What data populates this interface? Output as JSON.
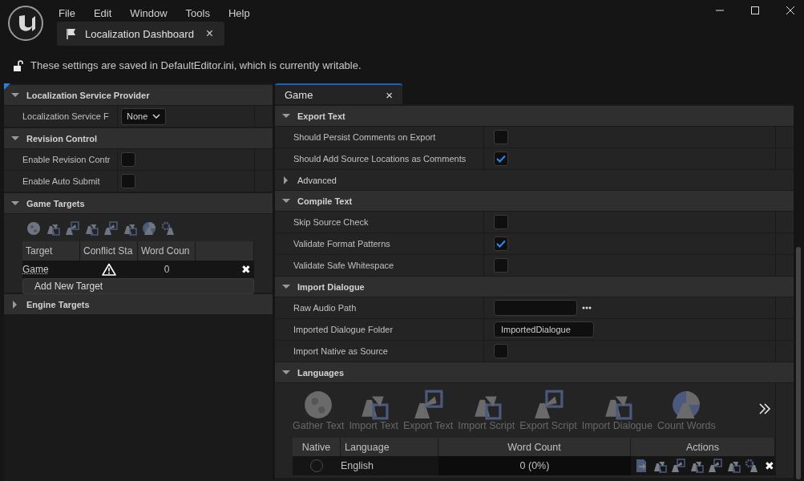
{
  "menu": [
    "File",
    "Edit",
    "Window",
    "Tools",
    "Help"
  ],
  "document_tab": {
    "label": "Localization Dashboard",
    "close": "×"
  },
  "notice": "These settings are saved in DefaultEditor.ini, which is currently writable.",
  "left_panel": {
    "sections": [
      {
        "kind": "properties",
        "title": "Localization Service Provider",
        "expanded": true,
        "rows": [
          {
            "kind": "dropdown",
            "label": "Localization Service F",
            "value": "None"
          }
        ]
      },
      {
        "kind": "properties",
        "title": "Revision Control",
        "expanded": true,
        "rows": [
          {
            "kind": "checkbox",
            "label": "Enable Revision Contr",
            "checked": false
          },
          {
            "kind": "checkbox",
            "label": "Enable Auto Submit",
            "checked": false
          }
        ]
      },
      {
        "kind": "targets",
        "title": "Game Targets",
        "expanded": true,
        "columns": [
          "Target",
          "Conflict Sta",
          "Word Coun"
        ],
        "rows": [
          {
            "target": "Game",
            "conflict": true,
            "word_count": "0",
            "remove": "✖"
          }
        ],
        "add_button": "Add New Target"
      },
      {
        "kind": "properties",
        "title": "Engine Targets",
        "expanded": false
      }
    ]
  },
  "editor_tab": {
    "label": "Game",
    "close": "×"
  },
  "right_panel": {
    "sections": [
      {
        "kind": "properties",
        "title": "Export Text",
        "expanded": true,
        "rows": [
          {
            "kind": "checkbox",
            "label": "Should Persist Comments on Export",
            "checked": false
          },
          {
            "kind": "checkbox",
            "label": "Should Add Source Locations as Comments",
            "checked": true
          }
        ]
      },
      {
        "kind": "group",
        "title": "Advanced",
        "expanded": false
      },
      {
        "kind": "properties",
        "title": "Compile Text",
        "expanded": true,
        "rows": [
          {
            "kind": "checkbox",
            "label": "Skip Source Check",
            "checked": false
          },
          {
            "kind": "checkbox",
            "label": "Validate Format Patterns",
            "checked": true
          },
          {
            "kind": "checkbox",
            "label": "Validate Safe Whitespace",
            "checked": false
          }
        ]
      },
      {
        "kind": "properties",
        "title": "Import Dialogue",
        "expanded": true,
        "rows": [
          {
            "kind": "path",
            "label": "Raw Audio Path"
          },
          {
            "kind": "text",
            "label": "Imported Dialogue Folder",
            "value": "ImportedDialogue"
          },
          {
            "kind": "checkbox",
            "label": "Import Native as Source",
            "checked": false
          }
        ]
      },
      {
        "kind": "languages",
        "title": "Languages",
        "expanded": true,
        "toolbar": [
          {
            "label": "Gather Text",
            "disabled": true
          },
          {
            "label": "Import Text",
            "disabled": true
          },
          {
            "label": "Export Text",
            "disabled": true
          },
          {
            "label": "Import Script",
            "disabled": true
          },
          {
            "label": "Export Script",
            "disabled": true
          },
          {
            "label": "Import Dialogue",
            "disabled": true
          },
          {
            "label": "Count Words",
            "disabled": true
          }
        ],
        "columns": [
          "Native",
          "Language",
          "Word Count",
          "Actions"
        ],
        "rows": [
          {
            "native": false,
            "language": "English",
            "word_count": "0 (0%)",
            "remove": "✖"
          }
        ]
      }
    ]
  }
}
